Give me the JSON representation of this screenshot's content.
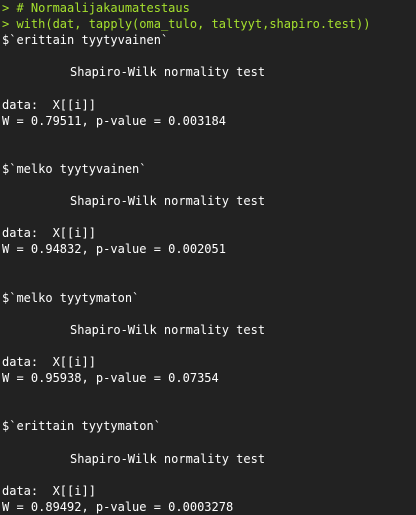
{
  "console": {
    "lines": [
      {
        "kind": "input",
        "prompt": ">",
        "text": " # Normaalijakaumatestaus"
      },
      {
        "kind": "input",
        "prompt": ">",
        "text": " with(dat, tapply(oma_tulo, taltyyt,shapiro.test))"
      },
      {
        "kind": "output",
        "text": "$`erittain tyytyvainen`"
      },
      {
        "kind": "blank",
        "text": ""
      },
      {
        "kind": "output",
        "indent": true,
        "text": "Shapiro-Wilk normality test"
      },
      {
        "kind": "blank",
        "text": ""
      },
      {
        "kind": "output",
        "text": "data:  X[[i]]"
      },
      {
        "kind": "output",
        "text": "W = 0.79511, p-value = 0.003184"
      },
      {
        "kind": "blank",
        "text": ""
      },
      {
        "kind": "blank",
        "text": ""
      },
      {
        "kind": "output",
        "text": "$`melko tyytyvainen`"
      },
      {
        "kind": "blank",
        "text": ""
      },
      {
        "kind": "output",
        "indent": true,
        "text": "Shapiro-Wilk normality test"
      },
      {
        "kind": "blank",
        "text": ""
      },
      {
        "kind": "output",
        "text": "data:  X[[i]]"
      },
      {
        "kind": "output",
        "text": "W = 0.94832, p-value = 0.002051"
      },
      {
        "kind": "blank",
        "text": ""
      },
      {
        "kind": "blank",
        "text": ""
      },
      {
        "kind": "output",
        "text": "$`melko tyytymaton`"
      },
      {
        "kind": "blank",
        "text": ""
      },
      {
        "kind": "output",
        "indent": true,
        "text": "Shapiro-Wilk normality test"
      },
      {
        "kind": "blank",
        "text": ""
      },
      {
        "kind": "output",
        "text": "data:  X[[i]]"
      },
      {
        "kind": "output",
        "text": "W = 0.95938, p-value = 0.07354"
      },
      {
        "kind": "blank",
        "text": ""
      },
      {
        "kind": "blank",
        "text": ""
      },
      {
        "kind": "output",
        "text": "$`erittain tyytymaton`"
      },
      {
        "kind": "blank",
        "text": ""
      },
      {
        "kind": "output",
        "indent": true,
        "text": "Shapiro-Wilk normality test"
      },
      {
        "kind": "blank",
        "text": ""
      },
      {
        "kind": "output",
        "text": "data:  X[[i]]"
      },
      {
        "kind": "output",
        "text": "W = 0.89492, p-value = 0.0003278"
      }
    ]
  },
  "colors": {
    "background": "#222222",
    "input_text": "#a6e22e",
    "output_text": "#ffffff"
  }
}
